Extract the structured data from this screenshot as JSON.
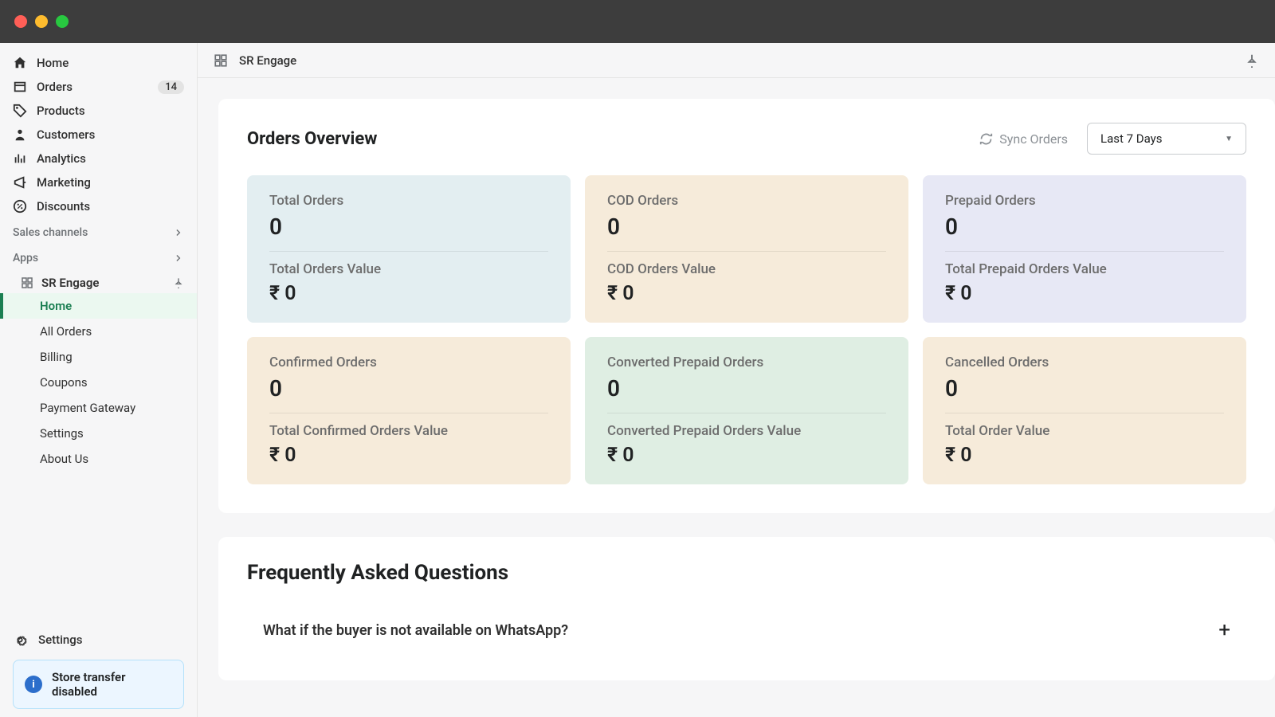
{
  "sidebar": {
    "nav": [
      {
        "icon": "home",
        "label": "Home"
      },
      {
        "icon": "orders",
        "label": "Orders",
        "badge": "14"
      },
      {
        "icon": "tag",
        "label": "Products"
      },
      {
        "icon": "person",
        "label": "Customers"
      },
      {
        "icon": "analytics",
        "label": "Analytics"
      },
      {
        "icon": "marketing",
        "label": "Marketing"
      },
      {
        "icon": "discount",
        "label": "Discounts"
      }
    ],
    "sales_channels_label": "Sales channels",
    "apps_label": "Apps",
    "app_name": "SR Engage",
    "app_items": [
      "Home",
      "All Orders",
      "Billing",
      "Coupons",
      "Payment Gateway",
      "Settings",
      "About Us"
    ],
    "app_active": 0,
    "settings_label": "Settings",
    "alert": "Store transfer disabled"
  },
  "topbar": {
    "title": "SR Engage"
  },
  "overview": {
    "title": "Orders Overview",
    "sync": "Sync Orders",
    "range": "Last 7 Days",
    "stats": [
      {
        "label": "Total Orders",
        "value": "0",
        "label2": "Total Orders Value",
        "value2": "₹ 0",
        "cls": "bg-blue"
      },
      {
        "label": "COD Orders",
        "value": "0",
        "label2": "COD Orders Value",
        "value2": "₹ 0",
        "cls": "bg-orange"
      },
      {
        "label": "Prepaid Orders",
        "value": "0",
        "label2": "Total Prepaid Orders Value",
        "value2": "₹ 0",
        "cls": "bg-purple"
      },
      {
        "label": "Confirmed Orders",
        "value": "0",
        "label2": "Total Confirmed Orders Value",
        "value2": "₹ 0",
        "cls": "bg-orange2"
      },
      {
        "label": "Converted Prepaid Orders",
        "value": "0",
        "label2": "Converted Prepaid Orders Value",
        "value2": "₹ 0",
        "cls": "bg-green"
      },
      {
        "label": "Cancelled Orders",
        "value": "0",
        "label2": "Total Order Value",
        "value2": "₹ 0",
        "cls": "bg-orange3"
      }
    ]
  },
  "faq": {
    "title": "Frequently Asked Questions",
    "items": [
      "What if the buyer is not available on WhatsApp?"
    ]
  }
}
